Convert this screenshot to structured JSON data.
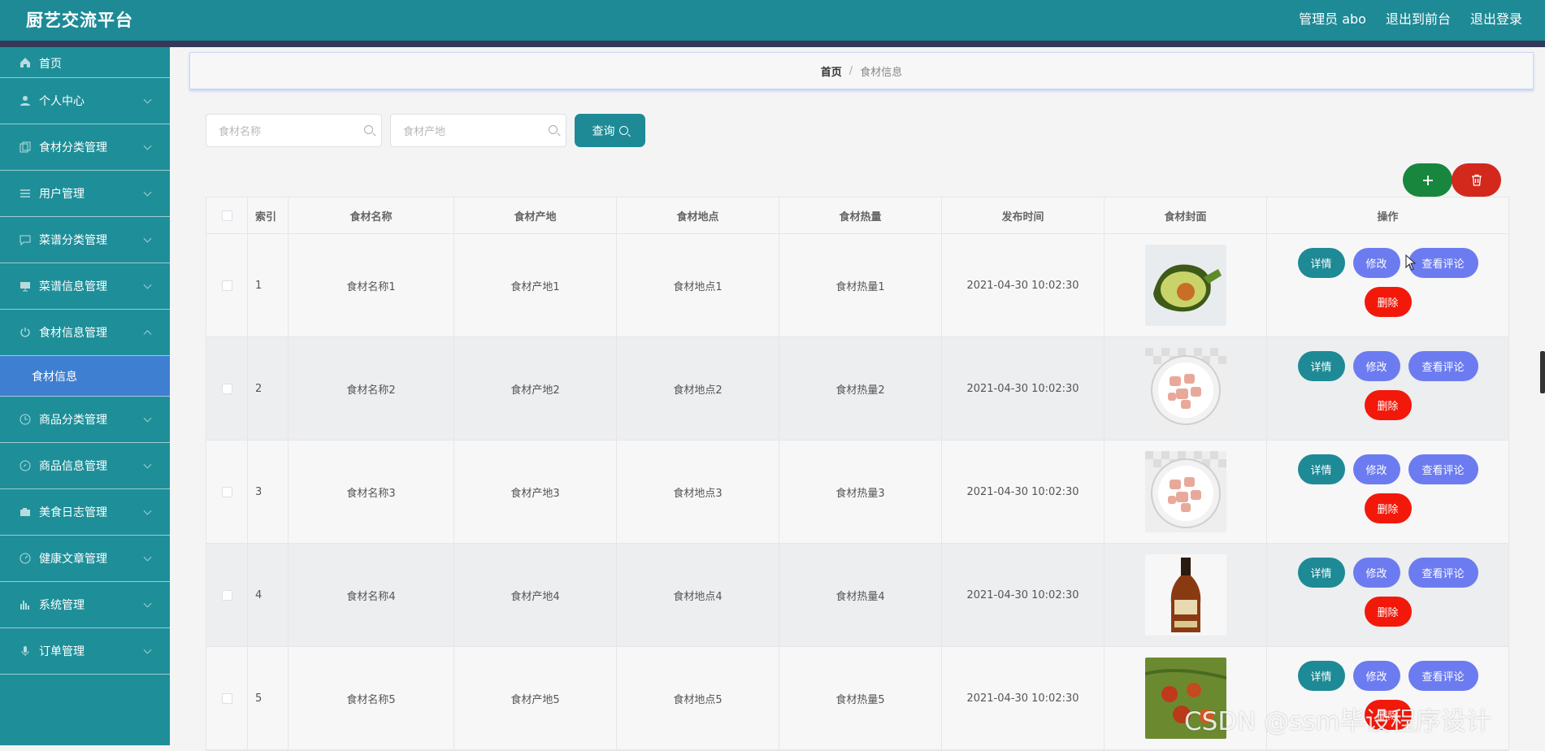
{
  "app": {
    "title": "厨艺交流平台"
  },
  "header": {
    "admin": "管理员 abo",
    "to_front": "退出到前台",
    "logout": "退出登录"
  },
  "sidebar": {
    "items": [
      {
        "label": "首页",
        "icon": "home-icon"
      },
      {
        "label": "个人中心",
        "icon": "user-icon"
      },
      {
        "label": "食材分类管理",
        "icon": "copy-icon"
      },
      {
        "label": "用户管理",
        "icon": "list-icon"
      },
      {
        "label": "菜谱分类管理",
        "icon": "chat-icon"
      },
      {
        "label": "菜谱信息管理",
        "icon": "monitor-icon"
      },
      {
        "label": "食材信息管理",
        "icon": "power-icon",
        "expanded": true
      },
      {
        "label": "商品分类管理",
        "icon": "clock-icon"
      },
      {
        "label": "商品信息管理",
        "icon": "compass-icon"
      },
      {
        "label": "美食日志管理",
        "icon": "camera-icon"
      },
      {
        "label": "健康文章管理",
        "icon": "gauge-icon"
      },
      {
        "label": "系统管理",
        "icon": "chart-icon"
      },
      {
        "label": "订单管理",
        "icon": "mic-icon"
      }
    ],
    "submenu": {
      "label": "食材信息"
    }
  },
  "breadcrumb": {
    "home": "首页",
    "separator": "/",
    "current": "食材信息"
  },
  "search": {
    "name_placeholder": "食材名称",
    "origin_placeholder": "食材产地",
    "query_label": "查询"
  },
  "toolbar": {
    "add_icon": "plus-icon",
    "delete_icon": "trash-icon",
    "add_color": "#18873d",
    "delete_color": "#d2291c"
  },
  "table": {
    "columns": [
      "索引",
      "食材名称",
      "食材产地",
      "食材地点",
      "食材热量",
      "发布时间",
      "食材封面",
      "操作"
    ],
    "rows": [
      {
        "idx": "1",
        "name": "食材名称1",
        "origin": "食材产地1",
        "location": "食材地点1",
        "calorie": "食材热量1",
        "time": "2021-04-30 10:02:30",
        "cover": "avocado"
      },
      {
        "idx": "2",
        "name": "食材名称2",
        "origin": "食材产地2",
        "location": "食材地点2",
        "calorie": "食材热量2",
        "time": "2021-04-30 10:02:30",
        "cover": "meat-plate"
      },
      {
        "idx": "3",
        "name": "食材名称3",
        "origin": "食材产地3",
        "location": "食材地点3",
        "calorie": "食材热量3",
        "time": "2021-04-30 10:02:30",
        "cover": "meat-plate"
      },
      {
        "idx": "4",
        "name": "食材名称4",
        "origin": "食材产地4",
        "location": "食材地点4",
        "calorie": "食材热量4",
        "time": "2021-04-30 10:02:30",
        "cover": "bottle"
      },
      {
        "idx": "5",
        "name": "食材名称5",
        "origin": "食材产地5",
        "location": "食材地点5",
        "calorie": "食材热量5",
        "time": "2021-04-30 10:02:30",
        "cover": "berries"
      }
    ],
    "actions": {
      "detail": "详情",
      "edit": "修改",
      "review": "查看评论",
      "delete": "删除"
    }
  },
  "watermark": "CSDN @ssm毕设程序设计",
  "colors": {
    "primary": "#1e8a96",
    "accent": "#6c7cf0",
    "danger": "#f2190b",
    "active_sub": "#3f7fd1"
  }
}
